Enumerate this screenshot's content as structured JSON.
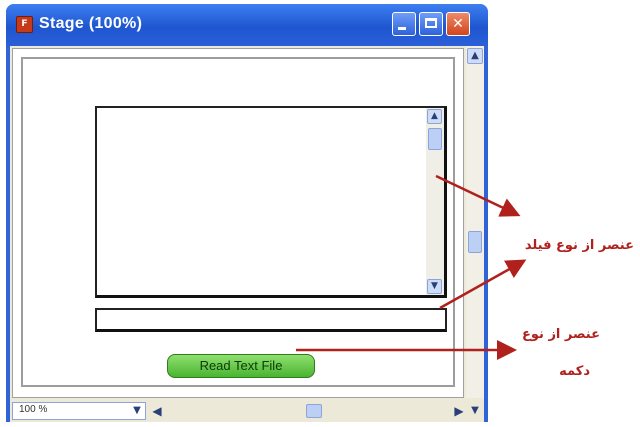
{
  "window": {
    "title": "Stage (100%)",
    "app_icon": "flash-app-icon",
    "controls": {
      "minimize": "minimize-icon",
      "maximize": "maximize-icon",
      "close": "close-icon"
    }
  },
  "stage": {
    "button_label": "Read Text File"
  },
  "statusbar": {
    "zoom_value": "100 %"
  },
  "annotations": {
    "textfield_label": "عنصر از نوع فیلد",
    "button_label_line1": "عنصر از نوع",
    "button_label_line2": "دکمه"
  },
  "colors": {
    "annotation": "#b0201c",
    "titlebar": "#2a5fd8",
    "button": "#5cc13e"
  }
}
